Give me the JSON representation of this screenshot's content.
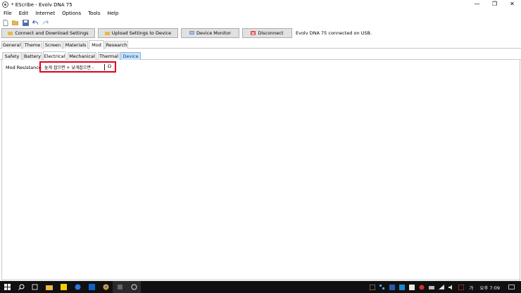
{
  "window": {
    "title": "* EScribe - Evolv DNA 75",
    "minimize": "—",
    "restore": "❐",
    "close": "✕"
  },
  "menu": [
    "File",
    "Edit",
    "Internet",
    "Options",
    "Tools",
    "Help"
  ],
  "actions": {
    "connect_download": "Connect and Download Settings",
    "upload": "Upload Settings to Device",
    "device_monitor": "Device Monitor",
    "disconnect": "Disconnect",
    "status": "Evolv DNA 75 connected on USB."
  },
  "main_tabs": [
    "General",
    "Theme",
    "Screen",
    "Materials",
    "Mod",
    "Research"
  ],
  "sub_tabs": [
    "Safety",
    "Battery",
    "Electrical",
    "Mechanical",
    "Thermal",
    "Device"
  ],
  "field": {
    "label": "Mod Resistance",
    "value": "높게 잡으면 + 낮게잡으면 -",
    "unit": "Ω"
  },
  "taskbar": {
    "time": "오후 7:09",
    "ime": "가"
  },
  "colors": {
    "highlight_border": "#e3001b",
    "disconnect": "#e04040",
    "device_tab": "#cce4f7"
  }
}
